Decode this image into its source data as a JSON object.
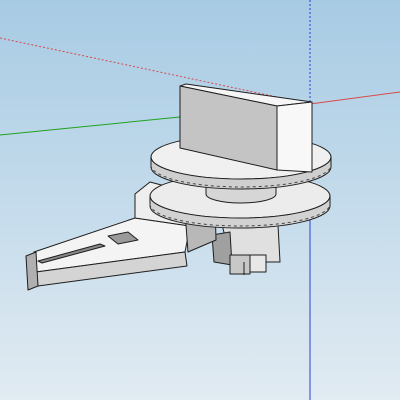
{
  "viewport": {
    "sky_top": "#a7cbe4",
    "sky_bottom": "#e1ebf2",
    "axis_red": "#d84a4a",
    "axis_green": "#21a121",
    "axis_blue": "#2a3fd6",
    "edge_color": "#1e1e1e",
    "face_light": "#f2f2f2",
    "face_mid": "#d8d8d8",
    "face_dark": "#9c9c9c"
  }
}
